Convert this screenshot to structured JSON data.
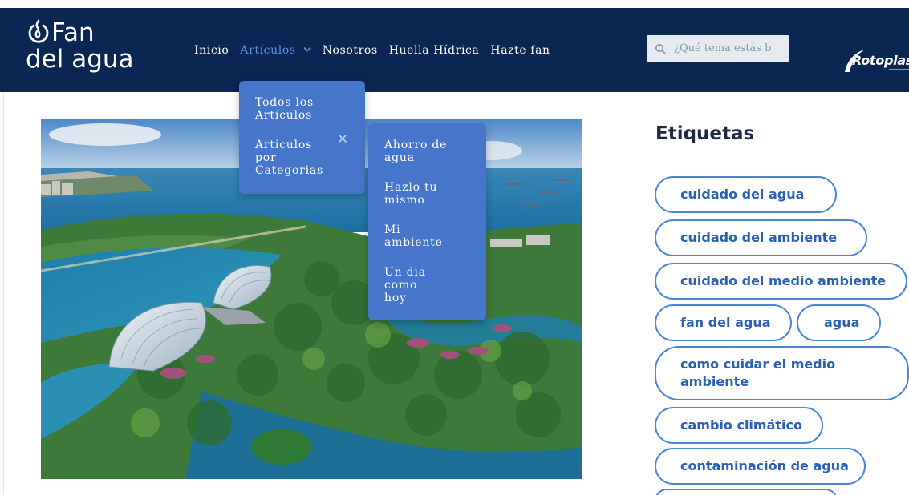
{
  "header": {
    "logo_line1": "Fan",
    "logo_line2": "del agua",
    "brand": "Rotoplas",
    "colors": {
      "header_bg": "#0a2753",
      "accent": "#5a93ea",
      "dropdown_bg": "#4576c9",
      "tag_border": "#4a86d8"
    }
  },
  "nav": {
    "items": [
      {
        "label": "Inicio"
      },
      {
        "label": "Artículos"
      },
      {
        "label": "Nosotros"
      },
      {
        "label": "Huella Hídrica"
      },
      {
        "label": "Hazte fan"
      }
    ]
  },
  "search": {
    "placeholder": "¿Qué tema estás b"
  },
  "dropdown": {
    "items": [
      {
        "label": "Todos los Artículos"
      },
      {
        "label": "Artículos por Categorias"
      }
    ],
    "close_icon": "close-icon"
  },
  "subdropdown": {
    "items": [
      {
        "label": "Ahorro de agua"
      },
      {
        "label": "Hazlo tu mismo"
      },
      {
        "label": "Mi ambiente"
      },
      {
        "label": "Un dia como hoy"
      }
    ]
  },
  "sidebar": {
    "title": "Etiquetas",
    "tags": [
      {
        "label": "cuidado del agua"
      },
      {
        "label": "cuidado del ambiente"
      },
      {
        "label": "cuidado del medio ambiente"
      },
      {
        "label": "fan del agua"
      },
      {
        "label": "agua"
      },
      {
        "label": "como cuidar el medio ambiente"
      },
      {
        "label": "cambio climático"
      },
      {
        "label": "contaminación de agua"
      }
    ]
  }
}
